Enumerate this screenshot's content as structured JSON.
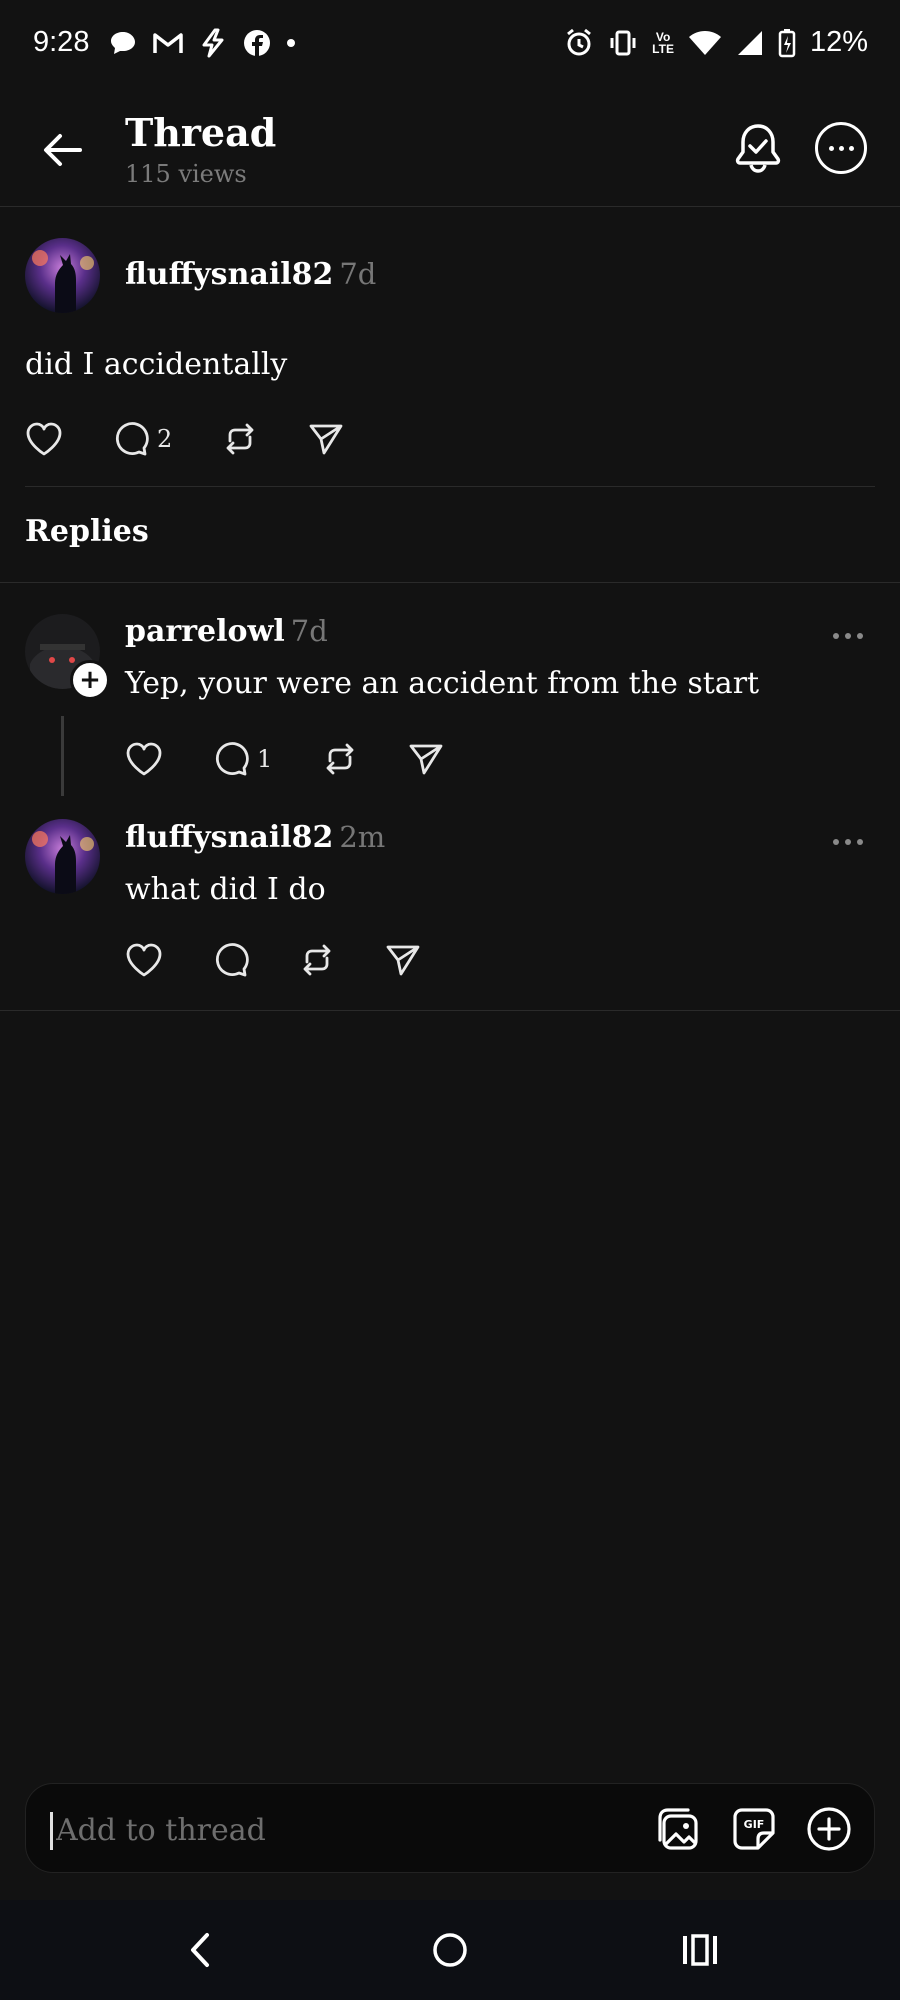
{
  "status_bar": {
    "time": "9:28",
    "battery": "12%",
    "network_label_top": "Vo",
    "network_label_bottom": "LTE"
  },
  "header": {
    "title": "Thread",
    "views": "115 views"
  },
  "post": {
    "username": "fluffysnail82",
    "time": "7d",
    "text": "did I accidentally",
    "reply_count": "2"
  },
  "replies_title": "Replies",
  "replies": [
    {
      "username": "parrelowl",
      "time": "7d",
      "text": "Yep, your were an accident from the start",
      "reply_count": "1"
    },
    {
      "username": "fluffysnail82",
      "time": "2m",
      "text": "what did I do",
      "reply_count": ""
    }
  ],
  "composer": {
    "placeholder": "Add to thread"
  },
  "colors": {
    "background": "#121212",
    "text": "#f2f2f2",
    "muted": "#777777",
    "divider": "#2a2a2a"
  }
}
